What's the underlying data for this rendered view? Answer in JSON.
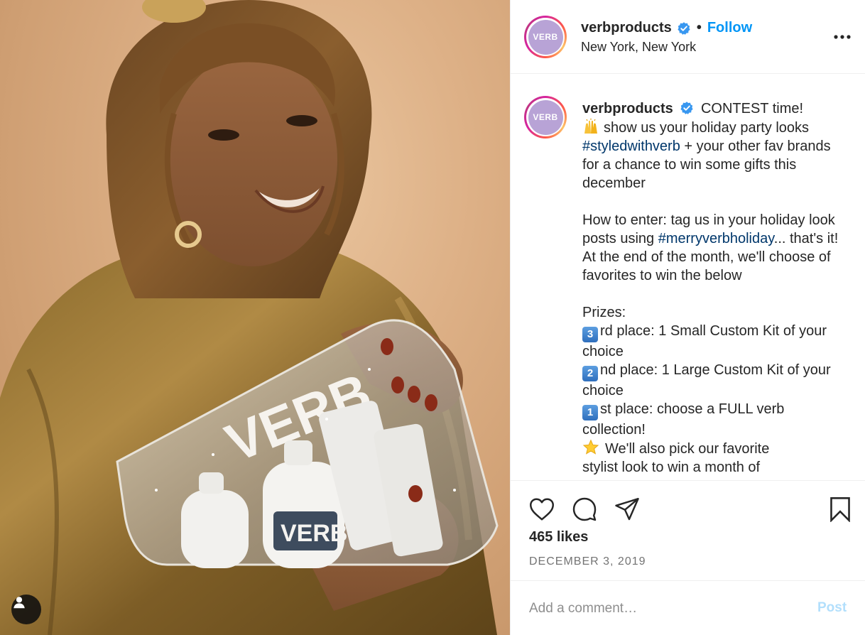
{
  "post": {
    "photo_icon": "user-tag-icon",
    "header": {
      "avatar_text": "VERB",
      "username": "verbproducts",
      "verified_icon": "verified-badge-icon",
      "separator": "•",
      "follow_label": "Follow",
      "location": "New York, New York",
      "more_icon": "more-options-icon"
    },
    "caption": {
      "avatar_text": "VERB",
      "username": "verbproducts",
      "line1": "CONTEST time!",
      "line2": "show us your holiday party looks",
      "hashtag1": "#styledwithverb",
      "line3": "+ your other fav brands for a chance to win some gifts this december",
      "line4": "How to enter: tag us in your holiday look posts using",
      "hashtag2": "#merryverbholiday",
      "line5": "... that's it! At the end of the month, we'll choose of favorites to win the below",
      "prizes_heading": "Prizes:",
      "prize3_key": "3",
      "prize3_text": "rd place: 1 Small Custom Kit of your choice",
      "prize2_key": "2",
      "prize2_text": "nd place: 1 Large Custom Kit of your choice",
      "prize1_key": "1",
      "prize1_text": "st place: choose a FULL verb collection!",
      "star_text": "We'll also pick our favorite",
      "cutoff_text": "stylist look to win a month of"
    },
    "actions": {
      "like_icon": "heart-icon",
      "comment_icon": "comment-icon",
      "share_icon": "share-icon",
      "save_icon": "bookmark-icon",
      "likes": "465 likes",
      "date": "DECEMBER 3, 2019"
    },
    "comment": {
      "placeholder": "Add a comment…",
      "post_label": "Post"
    },
    "colors": {
      "link_blue": "#0095f6",
      "hashtag": "#00376b",
      "post_disabled": "#b2dffc",
      "verified": "#3897f0"
    }
  }
}
